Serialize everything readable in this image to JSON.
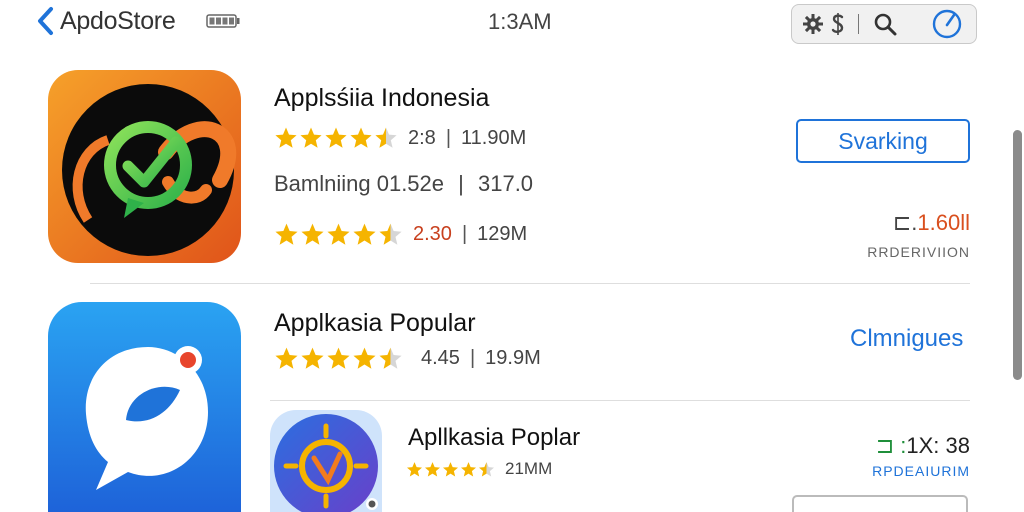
{
  "header": {
    "back_label": "ApdoStore",
    "time": "1:3AM"
  },
  "apps": [
    {
      "title": "Applsśiia Indonesia",
      "rating_a": "2:8",
      "size_a": "11.90M",
      "subtitle": "Bamlniing 01.52e",
      "subtitle_extra": "317.0",
      "rating_b": "2.30",
      "size_b": "129M",
      "action_label": "Svarking",
      "price": "1.60ll",
      "price_note": "RRDERIVIION",
      "stars": 4.5
    },
    {
      "title": "Applkasia Popular",
      "rating": "4.45",
      "size": "19.9M",
      "action_label": "Clmnigues",
      "stars": 4.5
    },
    {
      "title": "Apllkasia Poplar",
      "size": "21MM",
      "price": "1X: 38",
      "price_note": "RPDEAIURIM",
      "stars": 4.5
    }
  ],
  "colors": {
    "accent_blue": "#1f73d9",
    "star_gold": "#f5b400",
    "price_red": "#d94f1e",
    "price_green": "#1f8f3a"
  }
}
